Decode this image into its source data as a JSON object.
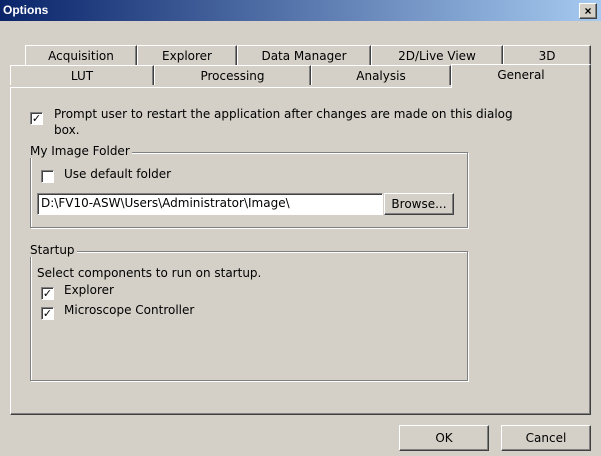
{
  "window": {
    "title": "Options",
    "close_symbol": "×"
  },
  "tabs": {
    "row1": [
      "Acquisition",
      "Explorer",
      "Data Manager",
      "2D/Live View",
      "3D"
    ],
    "row2": [
      "LUT",
      "Processing",
      "Analysis",
      "General"
    ],
    "active": "General"
  },
  "general": {
    "prompt_restart": {
      "checked": true,
      "label_line1": "Prompt user to restart the application after changes are made on this dialog",
      "label_line2": "box."
    },
    "image_folder": {
      "legend": "My Image Folder",
      "use_default": {
        "checked": false,
        "label": "Use default folder"
      },
      "path": "D:\\FV10-ASW\\Users\\Administrator\\Image\\",
      "browse_label": "Browse..."
    },
    "startup": {
      "legend": "Startup",
      "description": "Select components to run on startup.",
      "explorer": {
        "checked": true,
        "label": "Explorer"
      },
      "microscope_controller": {
        "checked": true,
        "label": "Microscope Controller"
      }
    }
  },
  "footer": {
    "ok_label": "OK",
    "cancel_label": "Cancel"
  },
  "check_mark": "✓"
}
